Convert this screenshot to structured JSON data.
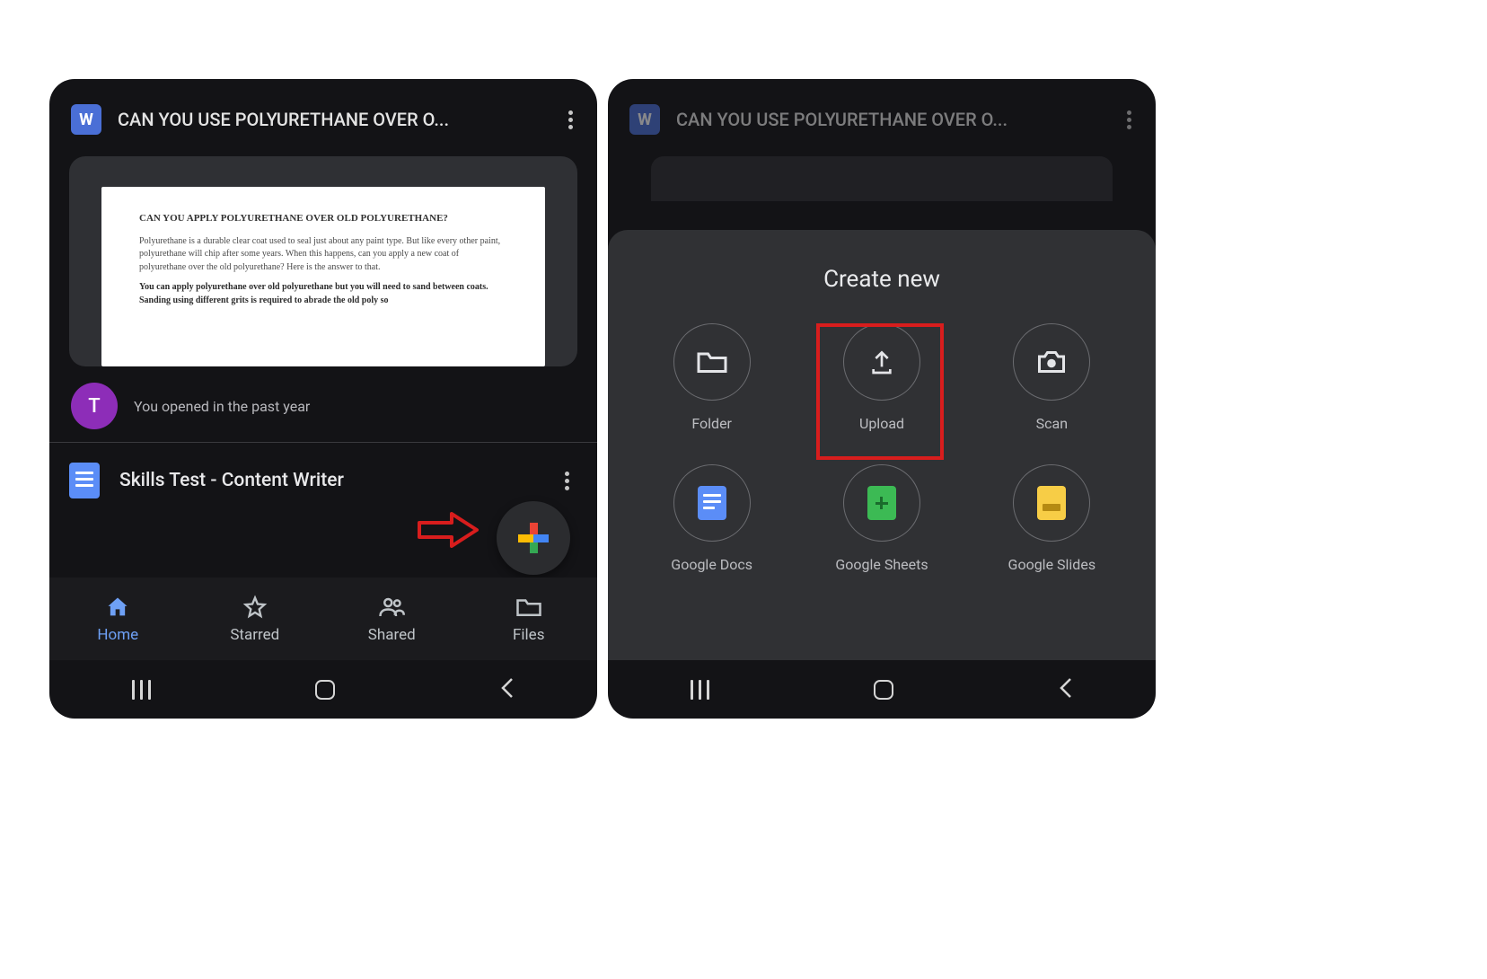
{
  "left": {
    "doc_badge": "W",
    "title": "CAN YOU USE POLYURETHANE OVER O...",
    "preview": {
      "heading": "CAN YOU APPLY POLYURETHANE OVER OLD POLYURETHANE?",
      "p1": "Polyurethane is a durable clear coat used to seal just about any paint type. But like every other paint, polyurethane will chip after some years. When this happens, can you apply a new coat of polyurethane over the old polyurethane? Here is the answer to that.",
      "p2": "You can apply polyurethane over old polyurethane but you will need to sand between coats. Sanding using different grits is required to abrade the old poly so"
    },
    "avatar_letter": "T",
    "activity": "You opened in the past year",
    "file2": "Skills Test - Content Writer",
    "nav": {
      "home": "Home",
      "starred": "Starred",
      "shared": "Shared",
      "files": "Files"
    }
  },
  "right": {
    "doc_badge": "W",
    "title": "CAN YOU USE POLYURETHANE OVER O...",
    "sheet_title": "Create new",
    "items": {
      "folder": "Folder",
      "upload": "Upload",
      "scan": "Scan",
      "docs": "Google Docs",
      "sheets": "Google Sheets",
      "slides": "Google Slides"
    }
  }
}
